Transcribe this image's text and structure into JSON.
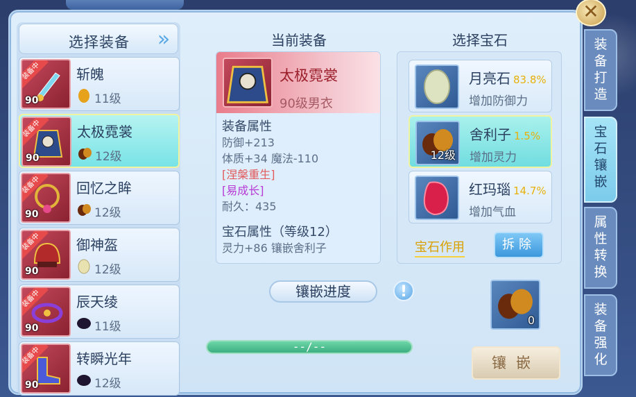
{
  "left_list": {
    "header": "选择装备",
    "items": [
      {
        "name": "斩魄",
        "level": "11级",
        "badge": "90",
        "tag": "装备中",
        "gem": "moonstone-gem-icon",
        "gem_color": "#e6a21a"
      },
      {
        "name": "太极霓裳",
        "level": "12级",
        "badge": "90",
        "tag": "装备中",
        "gem": "sarira-gem-icon",
        "gem_color": "#8a3d12"
      },
      {
        "name": "回忆之眸",
        "level": "12级",
        "badge": "90",
        "tag": "装备中",
        "gem": "sarira-gem-icon",
        "gem_color": "#8a3d12"
      },
      {
        "name": "御神盔",
        "level": "12级",
        "badge": "90",
        "tag": "装备中",
        "gem": "moonstone-gem-icon",
        "gem_color": "#e7e2b0"
      },
      {
        "name": "辰天绫",
        "level": "11级",
        "badge": "90",
        "tag": "装备中",
        "gem": "black-gem-icon",
        "gem_color": "#1f1530"
      },
      {
        "name": "转瞬光年",
        "level": "12级",
        "badge": "90",
        "tag": "装备中",
        "gem": "black-gem-icon",
        "gem_color": "#1f1530"
      }
    ]
  },
  "current_equipment": {
    "title": "当前装备",
    "name": "太极霓裳",
    "subtitle": "90级男衣",
    "attr_header": "装备属性",
    "attrs": [
      "防御+213",
      "体质+34 魔法-110"
    ],
    "special_red": "[涅槃重生]",
    "special_purple": "[易成长]",
    "durability": "耐久：435",
    "gem_attr_header": "宝石属性（等级12）",
    "gem_attr_line": "灵力+86 镶嵌舍利子"
  },
  "progress": {
    "label": "镶嵌进度",
    "value_text": "--/--"
  },
  "gems": {
    "title": "选择宝石",
    "items": [
      {
        "name": "月亮石",
        "pct": "83.8%",
        "desc": "增加防御力",
        "count": ""
      },
      {
        "name": "舍利子",
        "pct": "1.5%",
        "desc": "增加灵力",
        "count": "12级"
      },
      {
        "name": "红玛瑙",
        "pct": "14.7%",
        "desc": "增加气血",
        "count": ""
      }
    ],
    "effect_label": "宝石作用",
    "remove_label": "拆除"
  },
  "slot": {
    "count": "0"
  },
  "inlay_button": "镶嵌",
  "tabs": [
    "装备打造",
    "宝石镶嵌",
    "属性转换",
    "装备强化"
  ],
  "close_icon": "close-icon",
  "colors": {
    "accent": "#7ccbeb",
    "danger": "#e25a5a",
    "gold": "#e7b00a"
  }
}
